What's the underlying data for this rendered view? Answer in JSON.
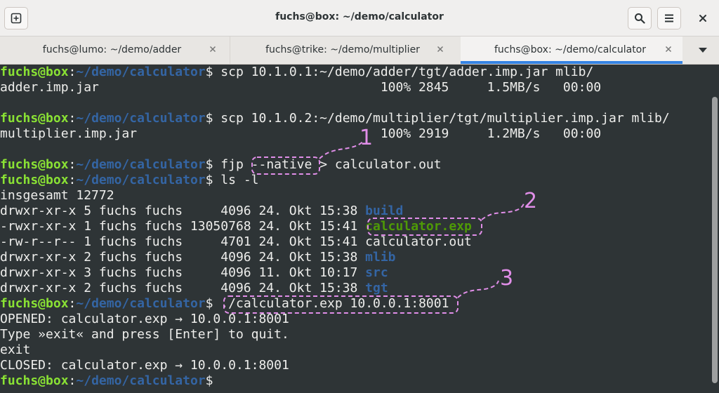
{
  "window": {
    "title": "fuchs@box: ~/demo/calculator"
  },
  "tabs": [
    {
      "label": "fuchs@lumo: ~/demo/adder"
    },
    {
      "label": "fuchs@trike: ~/demo/multiplier"
    },
    {
      "label": "fuchs@box: ~/demo/calculator"
    }
  ],
  "prompt": {
    "user": "fuchs@box",
    "sep": ":",
    "path": "~/demo/calculator",
    "sign": "$"
  },
  "terminal": {
    "cmd1": " scp 10.1.0.1:~/demo/adder/tgt/adder.imp.jar mlib/",
    "out1": "adder.imp.jar                                     100% 2845     1.5MB/s   00:00",
    "cmd2": " scp 10.1.0.2:~/demo/multiplier/tgt/multiplier.imp.jar mlib/",
    "out2": "multiplier.imp.jar                                100% 2919     1.2MB/s   00:00",
    "cmd3_pre": " fjp ",
    "cmd3_flag": "--native",
    "cmd3_post": " > calculator.out",
    "cmd4": " ls -l",
    "total": "insgesamt 12772",
    "ls": [
      {
        "meta": "drwxr-xr-x 5 fuchs fuchs     4096 24. Okt 15:38 ",
        "name": "build"
      },
      {
        "meta": "-rwxr-xr-x 1 fuchs fuchs 13050768 24. Okt 15:41 ",
        "name": "calculator.exp"
      },
      {
        "meta": "-rw-r--r-- 1 fuchs fuchs     4701 24. Okt 15:41 ",
        "name": "calculator.out"
      },
      {
        "meta": "drwxr-xr-x 2 fuchs fuchs     4096 24. Okt 15:38 ",
        "name": "mlib"
      },
      {
        "meta": "drwxr-xr-x 3 fuchs fuchs     4096 11. Okt 10:17 ",
        "name": "src"
      },
      {
        "meta": "drwxr-xr-x 2 fuchs fuchs     4096 24. Okt 15:38 ",
        "name": "tgt"
      }
    ],
    "cmd5": " ./calculator.exp 10.0.0.1:8001",
    "opened": "OPENED: calculator.exp → 10.0.0.1:8001",
    "type_exit": "Type »exit« and press [Enter] to quit.",
    "exit": "exit",
    "closed": "CLOSED: calculator.exp → 10.0.0.1:8001"
  },
  "annotations": {
    "one": "1",
    "two": "2",
    "three": "3"
  },
  "icons": {
    "new_tab": "new-tab-icon",
    "search": "search-icon",
    "menu": "hamburger-menu-icon",
    "close": "close-icon",
    "tab_close": "tab-close-icon",
    "tab_list": "chevron-down-icon"
  },
  "colors": {
    "terminal_bg": "#2e3436",
    "prompt_user": "#8ae234",
    "prompt_path": "#3465a4",
    "executable": "#4e9a06",
    "annotation": "#e08ee8",
    "active_tab_underline": "#3584e4"
  }
}
